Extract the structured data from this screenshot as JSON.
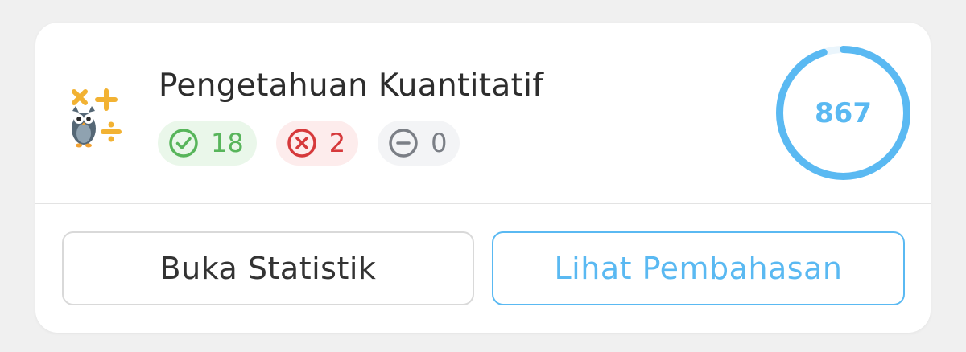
{
  "card": {
    "mascot_icon": "owl-math-mascot",
    "title": "Pengetahuan Kuantitatif",
    "stats": {
      "correct": {
        "icon": "check-circle-icon",
        "value": "18",
        "color": "#58b55b"
      },
      "wrong": {
        "icon": "x-circle-icon",
        "value": "2",
        "color": "#d6393b"
      },
      "empty": {
        "icon": "minus-circle-icon",
        "value": "0",
        "color": "#7b7f86"
      }
    },
    "score": {
      "value": "867",
      "progress": 0.95,
      "color": "#5ab9f2",
      "track_color": "#eaf5fc"
    }
  },
  "buttons": {
    "stats_label": "Buka Statistik",
    "review_label": "Lihat Pembahasan"
  }
}
